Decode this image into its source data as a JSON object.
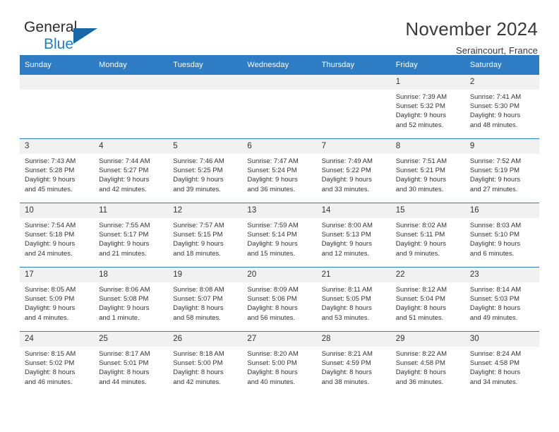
{
  "brand": {
    "name_part1": "General",
    "name_part2": "Blue",
    "logo_icon": "triangle-flag-icon"
  },
  "header": {
    "title": "November 2024",
    "location": "Seraincourt, France"
  },
  "calendar": {
    "weekday_headers": [
      "Sunday",
      "Monday",
      "Tuesday",
      "Wednesday",
      "Thursday",
      "Friday",
      "Saturday"
    ],
    "accent_color": "#2e7cc4",
    "daynum_band_color": "#f1f1f1",
    "weeks": [
      [
        {
          "day": "",
          "blank": true
        },
        {
          "day": "",
          "blank": true
        },
        {
          "day": "",
          "blank": true
        },
        {
          "day": "",
          "blank": true
        },
        {
          "day": "",
          "blank": true
        },
        {
          "day": "1",
          "sunrise": "Sunrise: 7:39 AM",
          "sunset": "Sunset: 5:32 PM",
          "daylight1": "Daylight: 9 hours",
          "daylight2": "and 52 minutes."
        },
        {
          "day": "2",
          "sunrise": "Sunrise: 7:41 AM",
          "sunset": "Sunset: 5:30 PM",
          "daylight1": "Daylight: 9 hours",
          "daylight2": "and 48 minutes."
        }
      ],
      [
        {
          "day": "3",
          "sunrise": "Sunrise: 7:43 AM",
          "sunset": "Sunset: 5:28 PM",
          "daylight1": "Daylight: 9 hours",
          "daylight2": "and 45 minutes."
        },
        {
          "day": "4",
          "sunrise": "Sunrise: 7:44 AM",
          "sunset": "Sunset: 5:27 PM",
          "daylight1": "Daylight: 9 hours",
          "daylight2": "and 42 minutes."
        },
        {
          "day": "5",
          "sunrise": "Sunrise: 7:46 AM",
          "sunset": "Sunset: 5:25 PM",
          "daylight1": "Daylight: 9 hours",
          "daylight2": "and 39 minutes."
        },
        {
          "day": "6",
          "sunrise": "Sunrise: 7:47 AM",
          "sunset": "Sunset: 5:24 PM",
          "daylight1": "Daylight: 9 hours",
          "daylight2": "and 36 minutes."
        },
        {
          "day": "7",
          "sunrise": "Sunrise: 7:49 AM",
          "sunset": "Sunset: 5:22 PM",
          "daylight1": "Daylight: 9 hours",
          "daylight2": "and 33 minutes."
        },
        {
          "day": "8",
          "sunrise": "Sunrise: 7:51 AM",
          "sunset": "Sunset: 5:21 PM",
          "daylight1": "Daylight: 9 hours",
          "daylight2": "and 30 minutes."
        },
        {
          "day": "9",
          "sunrise": "Sunrise: 7:52 AM",
          "sunset": "Sunset: 5:19 PM",
          "daylight1": "Daylight: 9 hours",
          "daylight2": "and 27 minutes."
        }
      ],
      [
        {
          "day": "10",
          "sunrise": "Sunrise: 7:54 AM",
          "sunset": "Sunset: 5:18 PM",
          "daylight1": "Daylight: 9 hours",
          "daylight2": "and 24 minutes."
        },
        {
          "day": "11",
          "sunrise": "Sunrise: 7:55 AM",
          "sunset": "Sunset: 5:17 PM",
          "daylight1": "Daylight: 9 hours",
          "daylight2": "and 21 minutes."
        },
        {
          "day": "12",
          "sunrise": "Sunrise: 7:57 AM",
          "sunset": "Sunset: 5:15 PM",
          "daylight1": "Daylight: 9 hours",
          "daylight2": "and 18 minutes."
        },
        {
          "day": "13",
          "sunrise": "Sunrise: 7:59 AM",
          "sunset": "Sunset: 5:14 PM",
          "daylight1": "Daylight: 9 hours",
          "daylight2": "and 15 minutes."
        },
        {
          "day": "14",
          "sunrise": "Sunrise: 8:00 AM",
          "sunset": "Sunset: 5:13 PM",
          "daylight1": "Daylight: 9 hours",
          "daylight2": "and 12 minutes."
        },
        {
          "day": "15",
          "sunrise": "Sunrise: 8:02 AM",
          "sunset": "Sunset: 5:11 PM",
          "daylight1": "Daylight: 9 hours",
          "daylight2": "and 9 minutes."
        },
        {
          "day": "16",
          "sunrise": "Sunrise: 8:03 AM",
          "sunset": "Sunset: 5:10 PM",
          "daylight1": "Daylight: 9 hours",
          "daylight2": "and 6 minutes."
        }
      ],
      [
        {
          "day": "17",
          "sunrise": "Sunrise: 8:05 AM",
          "sunset": "Sunset: 5:09 PM",
          "daylight1": "Daylight: 9 hours",
          "daylight2": "and 4 minutes."
        },
        {
          "day": "18",
          "sunrise": "Sunrise: 8:06 AM",
          "sunset": "Sunset: 5:08 PM",
          "daylight1": "Daylight: 9 hours",
          "daylight2": "and 1 minute."
        },
        {
          "day": "19",
          "sunrise": "Sunrise: 8:08 AM",
          "sunset": "Sunset: 5:07 PM",
          "daylight1": "Daylight: 8 hours",
          "daylight2": "and 58 minutes."
        },
        {
          "day": "20",
          "sunrise": "Sunrise: 8:09 AM",
          "sunset": "Sunset: 5:06 PM",
          "daylight1": "Daylight: 8 hours",
          "daylight2": "and 56 minutes."
        },
        {
          "day": "21",
          "sunrise": "Sunrise: 8:11 AM",
          "sunset": "Sunset: 5:05 PM",
          "daylight1": "Daylight: 8 hours",
          "daylight2": "and 53 minutes."
        },
        {
          "day": "22",
          "sunrise": "Sunrise: 8:12 AM",
          "sunset": "Sunset: 5:04 PM",
          "daylight1": "Daylight: 8 hours",
          "daylight2": "and 51 minutes."
        },
        {
          "day": "23",
          "sunrise": "Sunrise: 8:14 AM",
          "sunset": "Sunset: 5:03 PM",
          "daylight1": "Daylight: 8 hours",
          "daylight2": "and 49 minutes."
        }
      ],
      [
        {
          "day": "24",
          "sunrise": "Sunrise: 8:15 AM",
          "sunset": "Sunset: 5:02 PM",
          "daylight1": "Daylight: 8 hours",
          "daylight2": "and 46 minutes."
        },
        {
          "day": "25",
          "sunrise": "Sunrise: 8:17 AM",
          "sunset": "Sunset: 5:01 PM",
          "daylight1": "Daylight: 8 hours",
          "daylight2": "and 44 minutes."
        },
        {
          "day": "26",
          "sunrise": "Sunrise: 8:18 AM",
          "sunset": "Sunset: 5:00 PM",
          "daylight1": "Daylight: 8 hours",
          "daylight2": "and 42 minutes."
        },
        {
          "day": "27",
          "sunrise": "Sunrise: 8:20 AM",
          "sunset": "Sunset: 5:00 PM",
          "daylight1": "Daylight: 8 hours",
          "daylight2": "and 40 minutes."
        },
        {
          "day": "28",
          "sunrise": "Sunrise: 8:21 AM",
          "sunset": "Sunset: 4:59 PM",
          "daylight1": "Daylight: 8 hours",
          "daylight2": "and 38 minutes."
        },
        {
          "day": "29",
          "sunrise": "Sunrise: 8:22 AM",
          "sunset": "Sunset: 4:58 PM",
          "daylight1": "Daylight: 8 hours",
          "daylight2": "and 36 minutes."
        },
        {
          "day": "30",
          "sunrise": "Sunrise: 8:24 AM",
          "sunset": "Sunset: 4:58 PM",
          "daylight1": "Daylight: 8 hours",
          "daylight2": "and 34 minutes."
        }
      ]
    ]
  }
}
